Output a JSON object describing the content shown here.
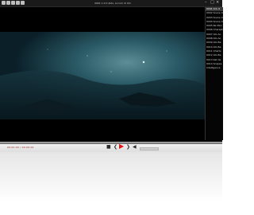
{
  "window": {
    "title": "0001 1.0 0 Aldo, al com dr 0m"
  },
  "playlist": {
    "items": [
      {
        "label": "0001 0.0, 0"
      },
      {
        "label": "0002 Scene 0"
      },
      {
        "label": "0003 Scene 0"
      },
      {
        "label": "0004 Scene 0"
      },
      {
        "label": "0005 Re Man"
      },
      {
        "label": "0006 Charapter"
      },
      {
        "label": "0007 Ato Ao"
      },
      {
        "label": "0008 Ato Ao"
      },
      {
        "label": "0009 Ato Ba"
      },
      {
        "label": "0010 Ato Ba"
      },
      {
        "label": "0011 Charts"
      },
      {
        "label": "0012 Ato Ba"
      },
      {
        "label": "0013 Kat de"
      },
      {
        "label": "0014 Scapes"
      },
      {
        "label": "Intelligence"
      }
    ]
  },
  "controls": {
    "time_text": "00:00:00 / 00:00:00",
    "stop_icon": "■",
    "prev_icon": "❮",
    "play_icon": "▶",
    "next_icon": "❯",
    "volume_icon": "◀"
  },
  "colors": {
    "accent": "#d01a1a",
    "video_teal": "#1d4a58"
  }
}
